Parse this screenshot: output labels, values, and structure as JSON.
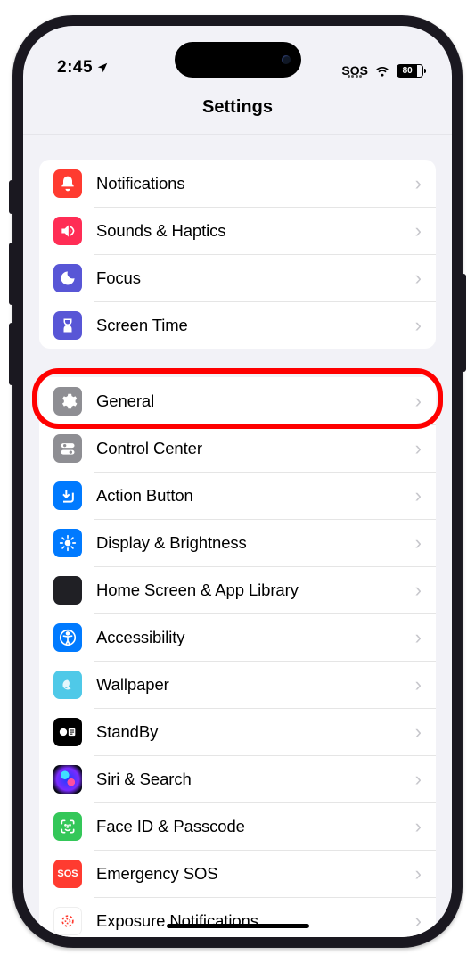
{
  "status": {
    "time": "2:45",
    "sos": "SOS",
    "battery": "80"
  },
  "header": {
    "title": "Settings"
  },
  "groups": [
    {
      "rows": [
        {
          "id": "notifications",
          "label": "Notifications"
        },
        {
          "id": "sounds-haptics",
          "label": "Sounds & Haptics"
        },
        {
          "id": "focus",
          "label": "Focus"
        },
        {
          "id": "screen-time",
          "label": "Screen Time"
        }
      ]
    },
    {
      "rows": [
        {
          "id": "general",
          "label": "General",
          "highlighted": true
        },
        {
          "id": "control-center",
          "label": "Control Center"
        },
        {
          "id": "action-button",
          "label": "Action Button"
        },
        {
          "id": "display-brightness",
          "label": "Display & Brightness"
        },
        {
          "id": "home-screen",
          "label": "Home Screen & App Library"
        },
        {
          "id": "accessibility",
          "label": "Accessibility"
        },
        {
          "id": "wallpaper",
          "label": "Wallpaper"
        },
        {
          "id": "standby",
          "label": "StandBy"
        },
        {
          "id": "siri-search",
          "label": "Siri & Search"
        },
        {
          "id": "face-id",
          "label": "Face ID & Passcode"
        },
        {
          "id": "emergency-sos",
          "label": "Emergency SOS"
        },
        {
          "id": "exposure",
          "label": "Exposure Notifications"
        }
      ]
    }
  ]
}
